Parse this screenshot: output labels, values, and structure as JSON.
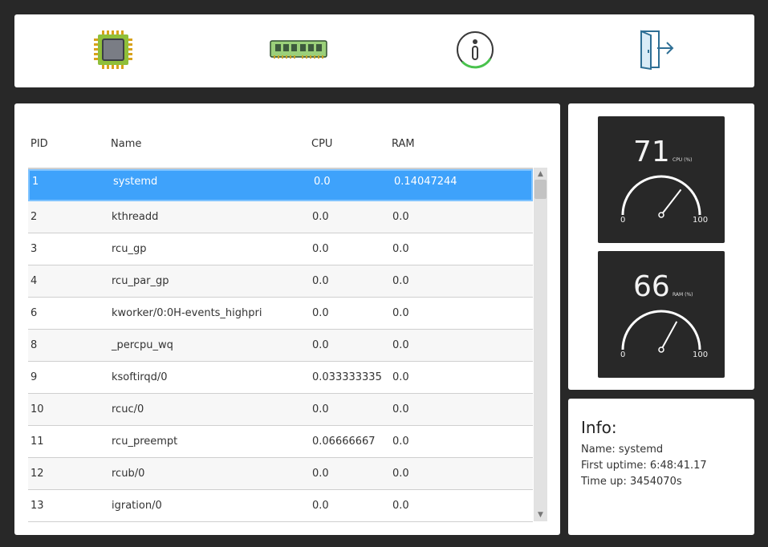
{
  "toolbar": {
    "buttons": [
      {
        "icon": "cpu-chip-icon"
      },
      {
        "icon": "ram-module-icon"
      },
      {
        "icon": "info-icon"
      },
      {
        "icon": "exit-door-icon"
      }
    ]
  },
  "table": {
    "headers": {
      "pid": "PID",
      "name": "Name",
      "cpu": "CPU",
      "ram": "RAM"
    },
    "rows": [
      {
        "pid": "1",
        "name": "systemd",
        "cpu": "0.0",
        "ram": "0.14047244"
      },
      {
        "pid": "2",
        "name": "kthreadd",
        "cpu": "0.0",
        "ram": "0.0"
      },
      {
        "pid": "3",
        "name": "rcu_gp",
        "cpu": "0.0",
        "ram": "0.0"
      },
      {
        "pid": "4",
        "name": "rcu_par_gp",
        "cpu": "0.0",
        "ram": "0.0"
      },
      {
        "pid": "6",
        "name": "kworker/0:0H-events_highpri",
        "cpu": "0.0",
        "ram": "0.0"
      },
      {
        "pid": "8",
        "name": "_percpu_wq",
        "cpu": "0.0",
        "ram": "0.0"
      },
      {
        "pid": "9",
        "name": "ksoftirqd/0",
        "cpu": "0.033333335",
        "ram": "0.0"
      },
      {
        "pid": "10",
        "name": "rcuc/0",
        "cpu": "0.0",
        "ram": "0.0"
      },
      {
        "pid": "11",
        "name": "rcu_preempt",
        "cpu": "0.06666667",
        "ram": "0.0"
      },
      {
        "pid": "12",
        "name": "rcub/0",
        "cpu": "0.0",
        "ram": "0.0"
      },
      {
        "pid": "13",
        "name": "igration/0",
        "cpu": "0.0",
        "ram": "0.0"
      }
    ],
    "selected_index": 0
  },
  "gauges": {
    "cpu": {
      "value": "71",
      "unit": "CPU (%)",
      "min": "0",
      "max": "100"
    },
    "ram": {
      "value": "66",
      "unit": "RAM (%)",
      "min": "0",
      "max": "100"
    }
  },
  "info": {
    "title": "Info:",
    "name_line": "Name: systemd",
    "uptime_line": "First uptime: 6:48:41.17",
    "timeup_line": "Time up: 3454070s"
  },
  "colors": {
    "background": "#282828",
    "selection": "#3ea2fb",
    "gauge_bg": "#282828"
  }
}
